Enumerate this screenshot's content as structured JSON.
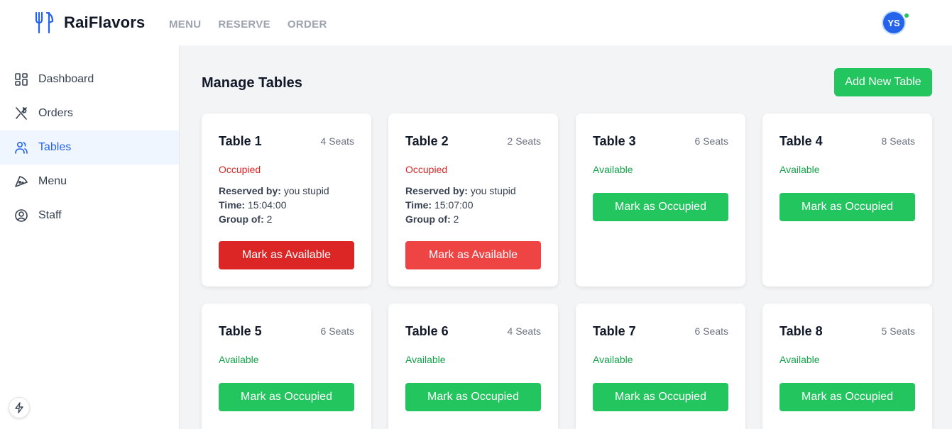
{
  "header": {
    "brand": "RaiFlavors",
    "nav": [
      "MENU",
      "RESERVE",
      "ORDER"
    ],
    "avatar_initials": "YS"
  },
  "sidebar": {
    "items": [
      {
        "label": "Dashboard",
        "icon": "dashboard-icon"
      },
      {
        "label": "Orders",
        "icon": "utensils-icon"
      },
      {
        "label": "Tables",
        "icon": "users-icon",
        "active": true
      },
      {
        "label": "Menu",
        "icon": "pizza-icon"
      },
      {
        "label": "Staff",
        "icon": "user-circle-icon"
      }
    ]
  },
  "main": {
    "title": "Manage Tables",
    "add_button": "Add New Table",
    "labels": {
      "reserved_by": "Reserved by:",
      "time": "Time:",
      "group_of": "Group of:"
    },
    "tables": [
      {
        "name": "Table 1",
        "seats": "4 Seats",
        "status": "Occupied",
        "reserved_by": "you stupid",
        "time": "15:04:00",
        "group": "2",
        "action": "Mark as Available"
      },
      {
        "name": "Table 2",
        "seats": "2 Seats",
        "status": "Occupied",
        "reserved_by": "you stupid",
        "time": "15:07:00",
        "group": "2",
        "action": "Mark as Available"
      },
      {
        "name": "Table 3",
        "seats": "6 Seats",
        "status": "Available",
        "action": "Mark as Occupied"
      },
      {
        "name": "Table 4",
        "seats": "8 Seats",
        "status": "Available",
        "action": "Mark as Occupied"
      },
      {
        "name": "Table 5",
        "seats": "6 Seats",
        "status": "Available",
        "action": "Mark as Occupied"
      },
      {
        "name": "Table 6",
        "seats": "4 Seats",
        "status": "Available",
        "action": "Mark as Occupied"
      },
      {
        "name": "Table 7",
        "seats": "6 Seats",
        "status": "Available",
        "action": "Mark as Occupied"
      },
      {
        "name": "Table 8",
        "seats": "5 Seats",
        "status": "Available",
        "action": "Mark as Occupied"
      }
    ]
  },
  "colors": {
    "accent": "#2563eb",
    "available": "#16a34a",
    "occupied": "#dc2626",
    "button_green": "#22c55e"
  }
}
